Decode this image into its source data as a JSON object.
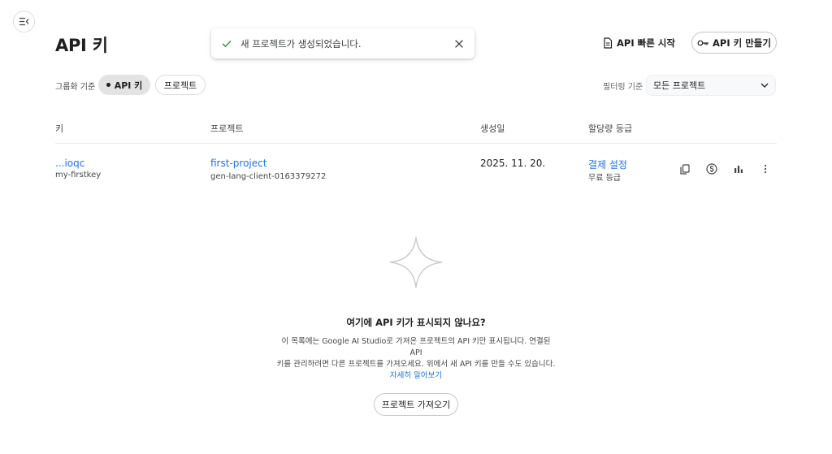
{
  "header": {
    "title": "API 키",
    "quickstart_label": "API 빠른 시작",
    "create_key_label": "API 키 만들기"
  },
  "toast": {
    "message": "새 프로젝트가 생성되었습니다."
  },
  "grouping": {
    "label": "그룹화 기준",
    "options": [
      "API 키",
      "프로젝트"
    ],
    "selected": "API 키"
  },
  "filter": {
    "label": "필터링 기준",
    "value": "모든 프로젝트"
  },
  "table": {
    "columns": [
      "키",
      "프로젝트",
      "생성일",
      "할당량 등급"
    ],
    "rows": [
      {
        "key": "...ioqc",
        "key_name": "my-firstkey",
        "project": "first-project",
        "project_id": "gen-lang-client-0163379272",
        "created": "2025. 11. 20.",
        "tier_link": "결제 설정",
        "tier": "무료 등급"
      }
    ]
  },
  "empty_state": {
    "title": "여기에 API 키가 표시되지 않나요?",
    "line1": "이 목록에는 Google AI Studio로 가져온 프로젝트의 API 키만 표시됩니다. 연결된 API",
    "line2": "키를 관리하려면 다른 프로젝트를 가져오세요. 위에서 새 API 키를 만들 수도 있습니다.",
    "learn_more": "자세히 알아보기",
    "import_label": "프로젝트 가져오기"
  },
  "colors": {
    "link": "#1a73e8",
    "toast_check": "#1e8e3e",
    "chip_active_bg": "#e3e3e3"
  },
  "icons": [
    "menu-collapse-icon",
    "check-icon",
    "close-icon",
    "document-icon",
    "key-icon",
    "chevron-down-icon",
    "copy-icon",
    "dollar-icon",
    "bar-chart-icon",
    "more-vert-icon",
    "sparkle-icon"
  ]
}
